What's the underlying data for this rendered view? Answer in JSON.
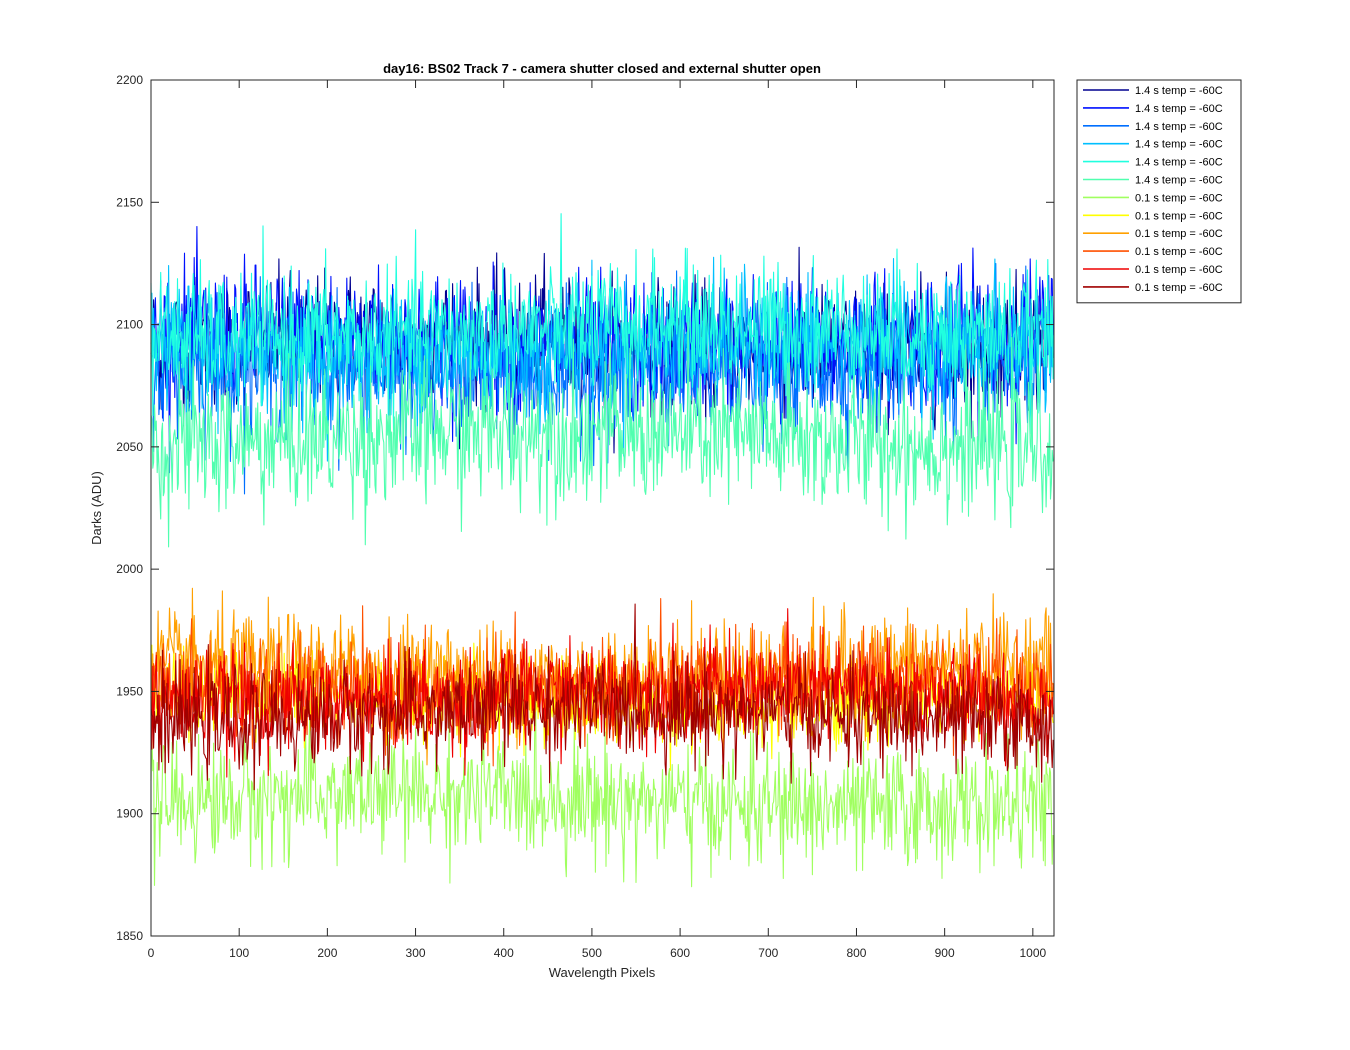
{
  "chart_data": {
    "type": "line",
    "title": "day16: BS02  Track 7 - camera shutter closed and external shutter open",
    "xlabel": "Wavelength Pixels",
    "ylabel": "Darks (ADU)",
    "xlim": [
      0,
      1024
    ],
    "ylim": [
      1850,
      2200
    ],
    "xticks": [
      0,
      100,
      200,
      300,
      400,
      500,
      600,
      700,
      800,
      900,
      1000
    ],
    "yticks": [
      1850,
      1900,
      1950,
      2000,
      2050,
      2100,
      2150,
      2200
    ],
    "grid": false,
    "legend_position": "outside-top-right",
    "series": [
      {
        "name": "1.4 s temp = -60C",
        "color": "#00008f",
        "mean": 2092,
        "noise": 13
      },
      {
        "name": "1.4 s temp = -60C",
        "color": "#0010ff",
        "mean": 2093,
        "noise": 14
      },
      {
        "name": "1.4 s temp = -60C",
        "color": "#006fff",
        "mean": 2082,
        "noise": 14
      },
      {
        "name": "1.4 s temp = -60C",
        "color": "#00bfff",
        "mean": 2090,
        "noise": 13
      },
      {
        "name": "1.4 s temp = -60C",
        "color": "#20ffdf",
        "mean": 2097,
        "noise": 13
      },
      {
        "name": "1.4 s temp = -60C",
        "color": "#50ffaf",
        "mean": 2053,
        "noise": 14
      },
      {
        "name": "0.1 s temp = -60C",
        "color": "#a0ff60",
        "mean": 1905,
        "noise": 12
      },
      {
        "name": "0.1 s temp = -60C",
        "color": "#ffff00",
        "mean": 1947,
        "noise": 9
      },
      {
        "name": "0.1 s temp = -60C",
        "color": "#ffa000",
        "mean": 1958,
        "noise": 11
      },
      {
        "name": "0.1 s temp = -60C",
        "color": "#ff5000",
        "mean": 1952,
        "noise": 10
      },
      {
        "name": "0.1 s temp = -60C",
        "color": "#ef0000",
        "mean": 1948,
        "noise": 10
      },
      {
        "name": "0.1 s temp = -60C",
        "color": "#a00000",
        "mean": 1940,
        "noise": 10
      }
    ]
  }
}
